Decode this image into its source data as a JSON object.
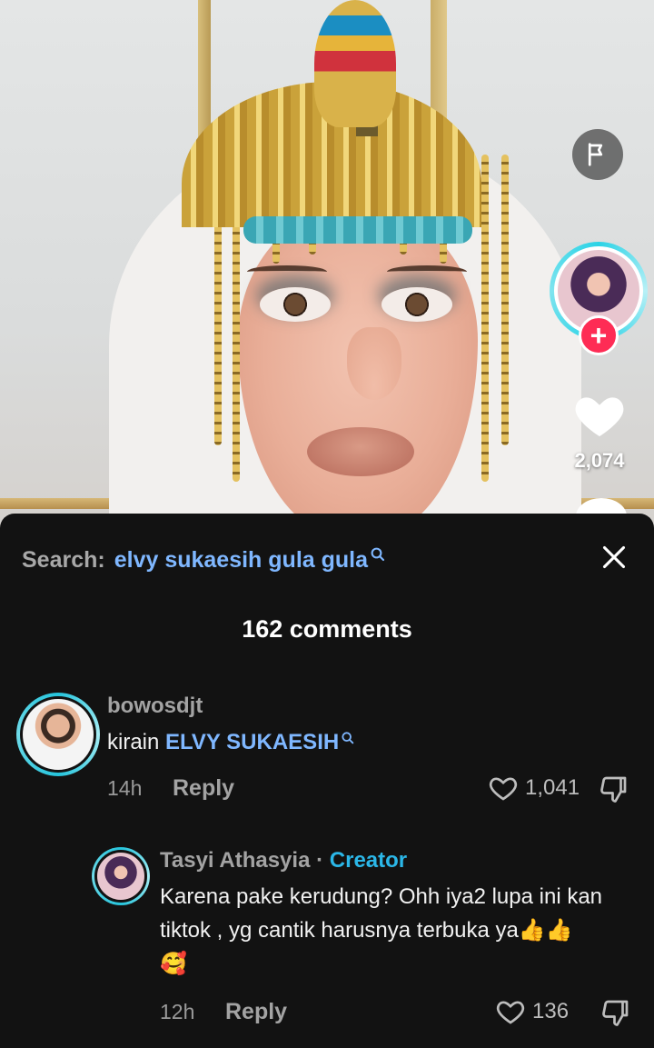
{
  "video": {
    "like_count": "2,074",
    "follow_symbol": "+"
  },
  "comments_sheet": {
    "search_label": "Search:",
    "search_query": "elvy sukaesih gula gula",
    "comments_count": "162 comments",
    "comments": [
      {
        "username": "bowosdjt",
        "text_prefix": "kirain ",
        "text_link": "ELVY SUKAESIH",
        "time": "14h",
        "reply_label": "Reply",
        "likes": "1,041"
      },
      {
        "username": "Tasyi Athasyia",
        "separator": "·",
        "badge": "Creator",
        "text_line1": "Karena pake kerudung? Ohh iya2 lupa ini kan",
        "text_line2": "tiktok , yg cantik harusnya terbuka ya👍👍",
        "text_line3": "🥰",
        "time": "12h",
        "reply_label": "Reply",
        "likes": "136"
      }
    ]
  },
  "icons": [
    "flag-icon",
    "heart-icon",
    "plus-icon",
    "search-icon",
    "close-icon",
    "heart-outline-icon",
    "thumbs-down-icon"
  ],
  "colors": {
    "sheet_bg": "#121212",
    "link_blue": "#7fb7ff",
    "creator_blue": "#2bb7e8",
    "follow_red": "#fe2c55",
    "avatar_ring": "#25c4dc"
  }
}
